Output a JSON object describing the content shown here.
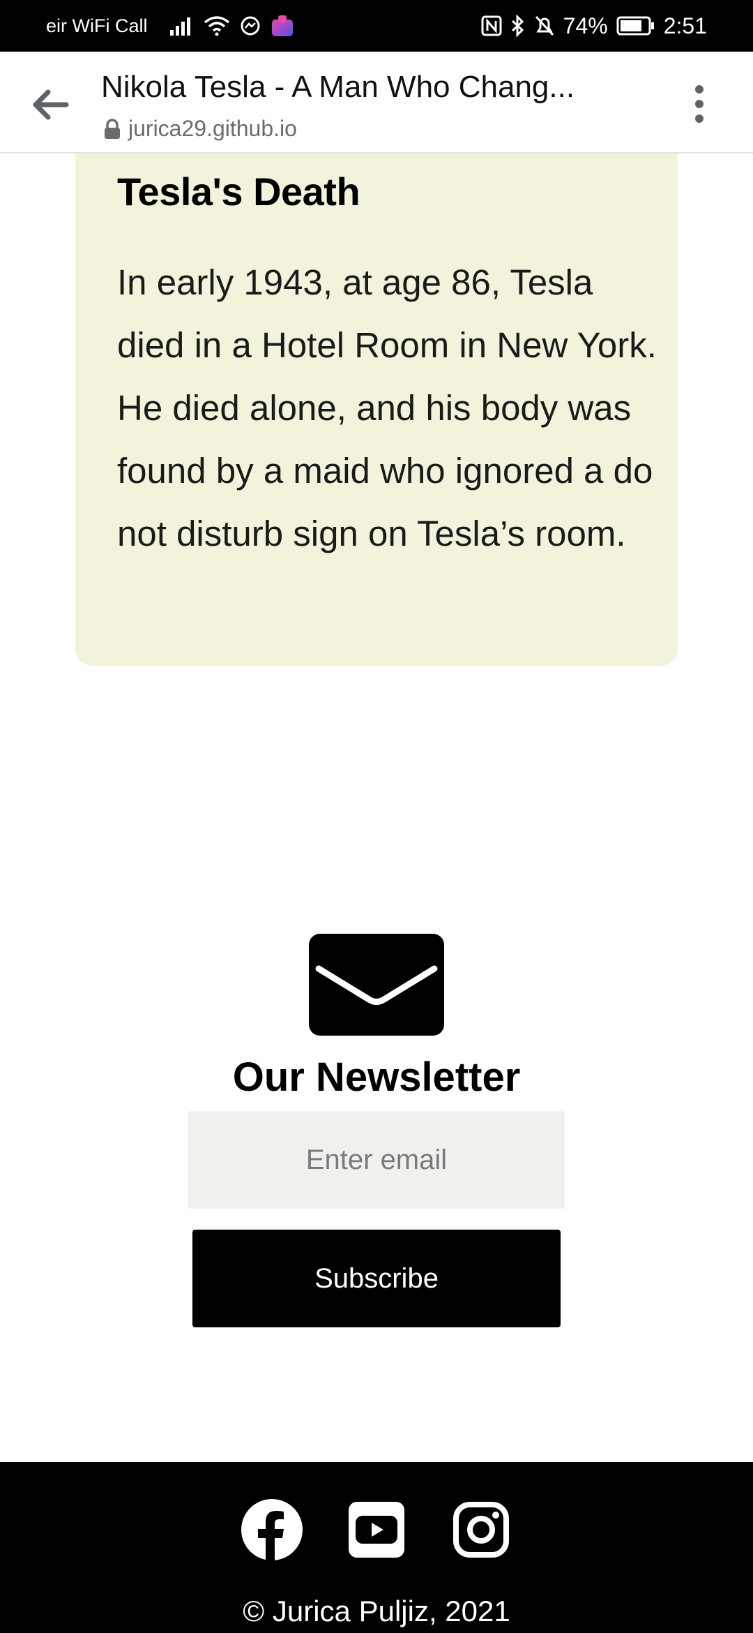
{
  "status_bar": {
    "carrier": "eir WiFi Call",
    "battery": "74%",
    "time": "2:51"
  },
  "browser": {
    "title": "Nikola Tesla - A Man Who Chang...",
    "url": "jurica29.github.io"
  },
  "card": {
    "heading": "Tesla's Death",
    "body": "In early 1943, at age 86, Tesla died in a Hotel Room in New York. He died alone, and his body was found by a maid who ignored a do not disturb sign on Tesla’s room."
  },
  "newsletter": {
    "title": "Our Newsletter",
    "email_placeholder": "Enter email",
    "subscribe_label": "Subscribe"
  },
  "footer": {
    "social": [
      "facebook-icon",
      "youtube-icon",
      "instagram-icon"
    ],
    "copyright": "© Jurica Puljiz, 2021"
  },
  "colors": {
    "card_background": "#f3f3dc",
    "input_background": "#eff2ec",
    "footer_background": "#000000"
  }
}
